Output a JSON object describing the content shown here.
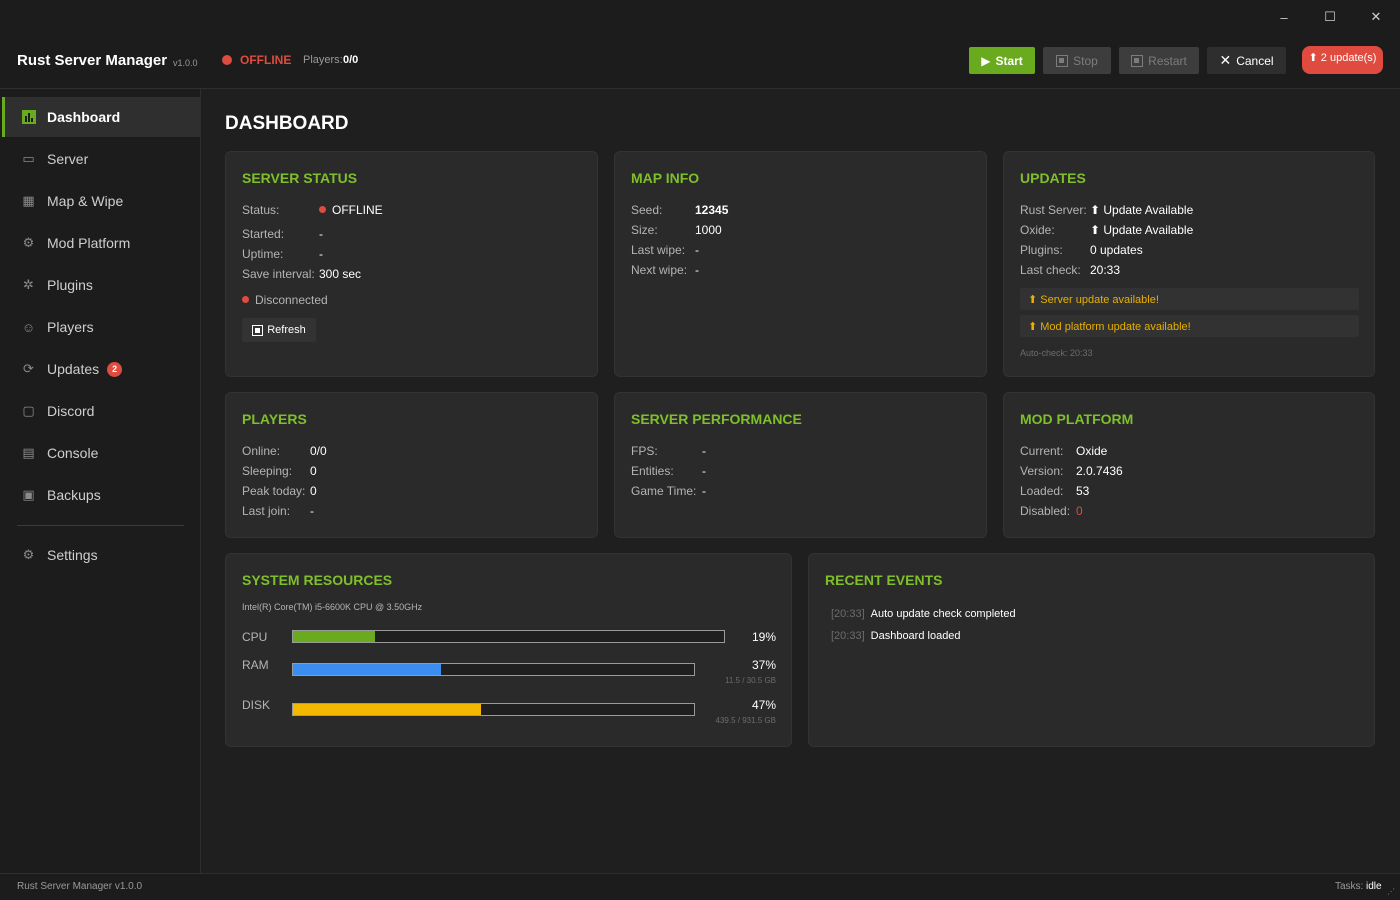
{
  "window": {
    "minimize_glyph": "–",
    "maximize_glyph": "☐",
    "close_glyph": "✕"
  },
  "header": {
    "title": "Rust Server Manager",
    "version": "v1.0.0",
    "status": "OFFLINE",
    "players_label": "Players:",
    "players_value": "0/0",
    "buttons": {
      "start": "Start",
      "stop": "Stop",
      "restart": "Restart",
      "cancel": "Cancel",
      "updates": "⬆ 2 update(s)"
    }
  },
  "sidebar": {
    "items": [
      {
        "label": "Dashboard",
        "icon": "dashboard-icon"
      },
      {
        "label": "Server",
        "icon": "server-icon"
      },
      {
        "label": "Map & Wipe",
        "icon": "map-icon"
      },
      {
        "label": "Mod Platform",
        "icon": "mod-icon"
      },
      {
        "label": "Plugins",
        "icon": "plugins-icon"
      },
      {
        "label": "Players",
        "icon": "players-icon"
      },
      {
        "label": "Updates",
        "icon": "updates-icon",
        "badge": "2"
      },
      {
        "label": "Discord",
        "icon": "discord-icon"
      },
      {
        "label": "Console",
        "icon": "console-icon"
      },
      {
        "label": "Backups",
        "icon": "backups-icon"
      },
      {
        "label": "Settings",
        "icon": "settings-icon"
      }
    ]
  },
  "main": {
    "page_title": "DASHBOARD",
    "server_status": {
      "title": "SERVER STATUS",
      "status_label": "Status:",
      "status_value": "OFFLINE",
      "started_label": "Started:",
      "started_value": "-",
      "uptime_label": "Uptime:",
      "uptime_value": "-",
      "save_label": "Save interval:",
      "save_value": "300 sec",
      "connection": "Disconnected",
      "refresh": "Refresh"
    },
    "map_info": {
      "title": "MAP INFO",
      "seed_label": "Seed:",
      "seed_value": "12345",
      "size_label": "Size:",
      "size_value": "1000",
      "last_wipe_label": "Last wipe:",
      "last_wipe_value": "-",
      "next_wipe_label": "Next wipe:",
      "next_wipe_value": "-"
    },
    "updates": {
      "title": "UPDATES",
      "rust_label": "Rust Server:",
      "rust_value": "⬆ Update Available",
      "oxide_label": "Oxide:",
      "oxide_value": "⬆ Update Available",
      "plugins_label": "Plugins:",
      "plugins_value": "0 updates",
      "last_check_label": "Last check:",
      "last_check_value": "20:33",
      "alert_server": "⬆ Server update available!",
      "alert_mod": "⬆ Mod platform update available!",
      "auto_check": "Auto-check: 20:33"
    },
    "players": {
      "title": "PLAYERS",
      "online_label": "Online:",
      "online_value": "0/0",
      "sleeping_label": "Sleeping:",
      "sleeping_value": "0",
      "peak_label": "Peak today:",
      "peak_value": "0",
      "last_join_label": "Last join:",
      "last_join_value": "-"
    },
    "performance": {
      "title": "SERVER PERFORMANCE",
      "fps_label": "FPS:",
      "fps_value": "-",
      "entities_label": "Entities:",
      "entities_value": "-",
      "game_time_label": "Game Time:",
      "game_time_value": "-"
    },
    "mod_platform": {
      "title": "MOD PLATFORM",
      "current_label": "Current:",
      "current_value": "Oxide",
      "version_label": "Version:",
      "version_value": "2.0.7436",
      "loaded_label": "Loaded:",
      "loaded_value": "53",
      "disabled_label": "Disabled:",
      "disabled_value": "0"
    },
    "system_resources": {
      "title": "SYSTEM RESOURCES",
      "cpu_model": "Intel(R) Core(TM) i5-6600K CPU @ 3.50GHz",
      "cpu": {
        "label": "CPU",
        "percent": 19,
        "percent_text": "19%"
      },
      "ram": {
        "label": "RAM",
        "percent": 37,
        "percent_text": "37%",
        "detail": "11.5 / 30.5 GB"
      },
      "disk": {
        "label": "DISK",
        "percent": 47,
        "percent_text": "47%",
        "detail": "439.5 / 931.5 GB"
      }
    },
    "recent_events": {
      "title": "RECENT EVENTS",
      "items": [
        {
          "time": "[20:33]",
          "message": "Auto update check completed"
        },
        {
          "time": "[20:33]",
          "message": "Dashboard loaded"
        }
      ]
    }
  },
  "statusbar": {
    "left": "Rust Server Manager  v1.0.0",
    "tasks_label": "Tasks:",
    "tasks_value": "idle"
  },
  "colors": {
    "accent": "#6aaa1f",
    "title_green": "#7fbf2a",
    "offline_red": "#e04b3f",
    "warning": "#e8b000",
    "cpu_bar": "#6aaa1f",
    "ram_bar": "#3b8ef0",
    "disk_bar": "#f5b800"
  }
}
